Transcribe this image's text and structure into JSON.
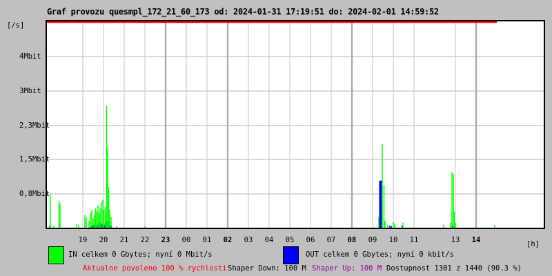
{
  "title": "Graf provozu quesmpl_172_21_60_173 od: 2024-01-31 17:19:51 do: 2024-02-01 14:59:52",
  "y_unit_label": "[/s]",
  "x_unit_label": "[h]",
  "legend": {
    "in_label": "IN celkem 0 Gbytes; nyní 0 Mbit/s",
    "in_color": "#00ff00",
    "out_label": "OUT celkem 0 Gbytes; nyní 0 kbit/s",
    "out_color": "#0000ff"
  },
  "footer": {
    "allowed_text": "Aktualne povoleno 100 % rychlosti",
    "allowed_color": "#ff0000",
    "shaper_down_text": "Shaper Down: 100 M",
    "shaper_up_text": "Shaper Up: 100 M",
    "shaper_up_color": "#990099",
    "availability_text": "Dostupnost 1301 z 1440 (90.3 %)"
  },
  "chart_data": {
    "type": "line",
    "description": "24h bandwidth graph; spikes of Mbit/s over time, x = hours (0 = 19:00 of 2024-01-31), grid hourly, label 12 missing (data gap), red line = allowed 100% speed drawn along top until current time 14:59",
    "x_axis": {
      "unit": "h",
      "ticks": [
        {
          "label": "19",
          "h": 0,
          "bold": false
        },
        {
          "label": "20",
          "h": 1,
          "bold": false
        },
        {
          "label": "21",
          "h": 2,
          "bold": false
        },
        {
          "label": "22",
          "h": 3,
          "bold": false
        },
        {
          "label": "23",
          "h": 4,
          "bold": true
        },
        {
          "label": "00",
          "h": 5,
          "bold": false
        },
        {
          "label": "01",
          "h": 6,
          "bold": false
        },
        {
          "label": "02",
          "h": 7,
          "bold": true
        },
        {
          "label": "03",
          "h": 8,
          "bold": false
        },
        {
          "label": "04",
          "h": 9,
          "bold": false
        },
        {
          "label": "05",
          "h": 10,
          "bold": false
        },
        {
          "label": "06",
          "h": 11,
          "bold": false
        },
        {
          "label": "07",
          "h": 12,
          "bold": false
        },
        {
          "label": "08",
          "h": 13,
          "bold": true
        },
        {
          "label": "09",
          "h": 14,
          "bold": false
        },
        {
          "label": "10",
          "h": 15,
          "bold": false
        },
        {
          "label": "11",
          "h": 16,
          "bold": false
        },
        {
          "label": "13",
          "h": 18,
          "bold": false
        },
        {
          "label": "14",
          "h": 19,
          "bold": true
        }
      ]
    },
    "y_axis": {
      "unit": "Mbit/s",
      "ticks": [
        {
          "label": "4Mbit",
          "v": 4.0
        },
        {
          "label": "3Mbit",
          "v": 3.0
        },
        {
          "label": "2,3Mbit",
          "v": 2.3
        },
        {
          "label": "1,5Mbit",
          "v": 1.5
        },
        {
          "label": "0,8Mbit",
          "v": 0.8
        }
      ]
    },
    "allowed_line": {
      "color": "#ff0000",
      "from_h": -1.73,
      "to_h": 20.0,
      "level": "100%"
    },
    "series": [
      {
        "name": "IN",
        "color": "#00ff00",
        "points": [
          [
            -1.567,
            0.78
          ],
          [
            -1.4,
            0.05
          ],
          [
            -1.15,
            0.62
          ],
          [
            -1.1,
            0.55
          ],
          [
            -0.3,
            0.08
          ],
          [
            -0.2,
            0.06
          ],
          [
            0.1,
            0.29
          ],
          [
            0.167,
            0.24
          ],
          [
            0.3,
            0.16
          ],
          [
            0.367,
            0.36
          ],
          [
            0.433,
            0.41
          ],
          [
            0.5,
            0.22
          ],
          [
            0.567,
            0.3
          ],
          [
            0.617,
            0.45
          ],
          [
            0.667,
            0.38
          ],
          [
            0.733,
            0.52
          ],
          [
            0.783,
            0.34
          ],
          [
            0.833,
            0.46
          ],
          [
            0.9,
            0.59
          ],
          [
            0.967,
            0.65
          ],
          [
            1.017,
            0.42
          ],
          [
            1.083,
            0.49
          ],
          [
            1.15,
            2.85
          ],
          [
            1.2,
            1.85
          ],
          [
            1.25,
            0.95
          ],
          [
            1.3,
            0.42
          ],
          [
            1.367,
            0.25
          ],
          [
            1.633,
            0.04
          ],
          [
            3.0,
            0.03
          ],
          [
            14.3,
            0.25
          ],
          [
            14.467,
            1.95
          ],
          [
            14.55,
            1.0
          ],
          [
            14.6,
            0.16
          ],
          [
            14.733,
            0.07
          ],
          [
            15.0,
            0.13
          ],
          [
            15.067,
            0.1
          ],
          [
            15.467,
            0.12
          ],
          [
            17.433,
            0.07
          ],
          [
            17.767,
            0.12
          ],
          [
            17.833,
            1.3
          ],
          [
            17.9,
            1.26
          ],
          [
            17.95,
            0.38
          ],
          [
            18.0,
            0.1
          ],
          [
            19.9,
            0.06
          ]
        ]
      },
      {
        "name": "OUT",
        "color": "#0000ff",
        "points": [
          [
            -1.6,
            0.04
          ],
          [
            0.45,
            0.05,
            3
          ],
          [
            0.55,
            0.07,
            3
          ],
          [
            0.65,
            0.06,
            3
          ],
          [
            0.75,
            0.08,
            3
          ],
          [
            0.85,
            0.1,
            3
          ],
          [
            0.95,
            0.08,
            3
          ],
          [
            1.05,
            0.07,
            3
          ],
          [
            1.15,
            0.13,
            3
          ],
          [
            1.25,
            0.15,
            3
          ],
          [
            1.35,
            0.05,
            3
          ],
          [
            14.383,
            1.1,
            4
          ],
          [
            14.833,
            0.05
          ],
          [
            14.9,
            0.04
          ],
          [
            15.433,
            0.05
          ],
          [
            17.867,
            0.04
          ]
        ]
      }
    ]
  }
}
